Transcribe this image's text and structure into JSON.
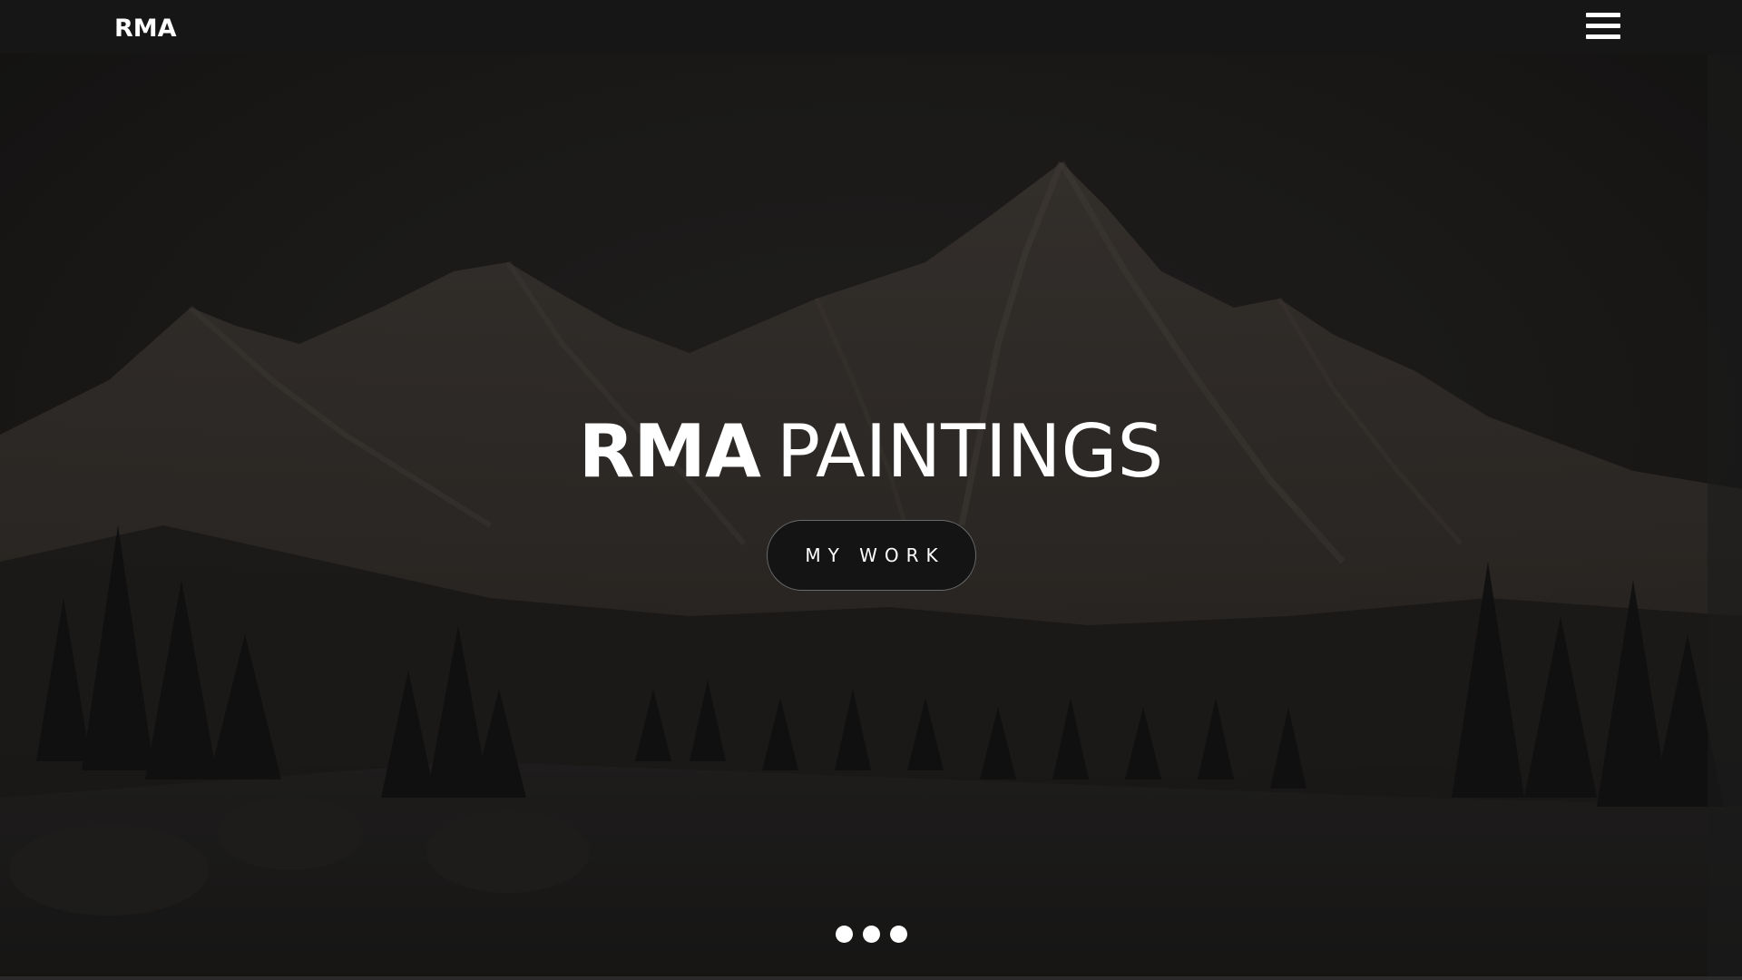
{
  "navbar": {
    "brand": "RMA",
    "menu_icon": "hamburger-menu-icon"
  },
  "hero": {
    "title_bold": "RMA",
    "title_light": "PAINTINGS",
    "cta_label": "MY WORK",
    "background": "dark mountain landscape painting",
    "slides_count": 3
  },
  "colors": {
    "navbar_bg": "#161617",
    "text": "#ffffff",
    "button_bg": "#141415",
    "button_border": "#6a6a6a"
  }
}
